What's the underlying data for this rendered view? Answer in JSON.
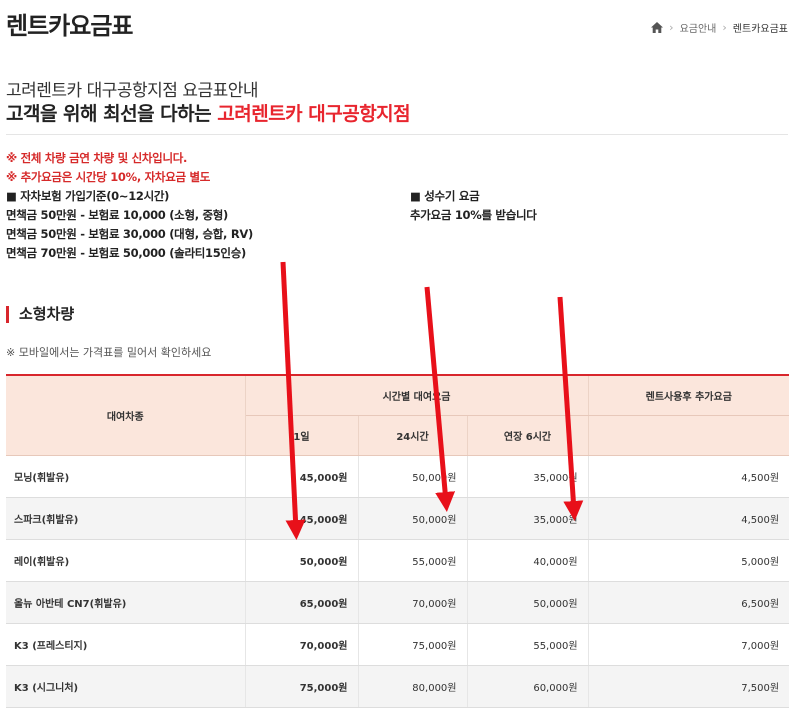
{
  "header": {
    "title": "렌트카요금표",
    "breadcrumb": [
      "요금안내",
      "렌트카요금표"
    ]
  },
  "intro": {
    "line1": "고려렌트카 대구공항지점 요금표안내",
    "line2_prefix": "고객을 위해 최선을 다하는 ",
    "line2_highlight": "고려렌트카 대구공항지점"
  },
  "notices": [
    "※ 전체 차량 금연 차량 및 신차입니다.",
    "※ 추가요금은 시간당 10%, 자차요금 별도"
  ],
  "insurance": {
    "heading": "■ 자차보험 가입기준(0~12시간)",
    "lines": [
      "면책금 50만원 - 보험료 10,000 (소형, 중형)",
      "면책금 50만원 - 보험료 30,000 (대형, 승합, RV)",
      "면책금 70만원 - 보험료 50,000 (솔라티15인승)"
    ]
  },
  "peak": {
    "heading": "■ 성수기 요금",
    "text": "추가요금 10%를 받습니다"
  },
  "section": {
    "title": "소형차량",
    "mobile_note": "※ 모바일에서는 가격표를 밀어서 확인하세요"
  },
  "table": {
    "head": {
      "vehicle": "대여차종",
      "hourly_group": "시간별 대여요금",
      "extra": "렌트사용후 추가요금",
      "sub": [
        "1일",
        "24시간",
        "연장 6시간"
      ]
    },
    "rows": [
      {
        "name": "모닝(휘발유)",
        "c1": "45,000원",
        "c2": "50,000원",
        "c3": "35,000원",
        "extra": "4,500원"
      },
      {
        "name": "스파크(휘발유)",
        "c1": "45,000원",
        "c2": "50,000원",
        "c3": "35,000원",
        "extra": "4,500원"
      },
      {
        "name": "레이(휘발유)",
        "c1": "50,000원",
        "c2": "55,000원",
        "c3": "40,000원",
        "extra": "5,000원"
      },
      {
        "name": "올뉴 아반테 CN7(휘발유)",
        "c1": "65,000원",
        "c2": "70,000원",
        "c3": "50,000원",
        "extra": "6,500원"
      },
      {
        "name": "K3 (프레스티지)",
        "c1": "70,000원",
        "c2": "75,000원",
        "c3": "55,000원",
        "extra": "7,000원"
      },
      {
        "name": "K3 (시그니처)",
        "c1": "75,000원",
        "c2": "80,000원",
        "c3": "60,000원",
        "extra": "7,500원"
      }
    ]
  },
  "colors": {
    "accent": "#e8252e",
    "header_bg": "#fbe6dc",
    "arrow": "#e8101a"
  }
}
